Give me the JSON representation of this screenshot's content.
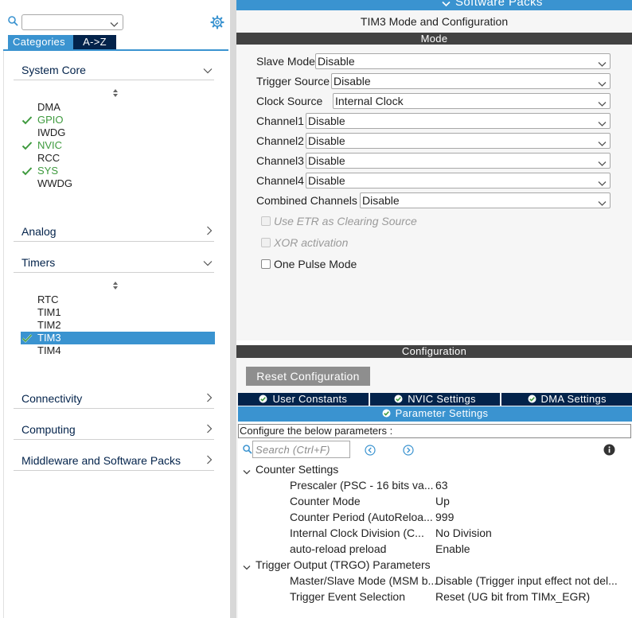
{
  "left_panel": {
    "tabs": [
      "Categories",
      "A->Z"
    ],
    "categories": [
      {
        "label": "System Core",
        "expanded": true,
        "items": [
          {
            "label": "DMA",
            "configured": false
          },
          {
            "label": "GPIO",
            "configured": true
          },
          {
            "label": "IWDG",
            "configured": false
          },
          {
            "label": "NVIC",
            "configured": true
          },
          {
            "label": "RCC",
            "configured": false
          },
          {
            "label": "SYS",
            "configured": true
          },
          {
            "label": "WWDG",
            "configured": false
          }
        ]
      },
      {
        "label": "Analog",
        "expanded": false
      },
      {
        "label": "Timers",
        "expanded": true,
        "items": [
          {
            "label": "RTC",
            "configured": false
          },
          {
            "label": "TIM1",
            "configured": false
          },
          {
            "label": "TIM2",
            "configured": false
          },
          {
            "label": "TIM3",
            "configured": true,
            "selected": true
          },
          {
            "label": "TIM4",
            "configured": false
          }
        ]
      },
      {
        "label": "Connectivity",
        "expanded": false
      },
      {
        "label": "Computing",
        "expanded": false
      },
      {
        "label": "Middleware and Software Packs",
        "expanded": false
      }
    ]
  },
  "top_bar": {
    "label": "Software Packs"
  },
  "right_panel": {
    "title": "TIM3 Mode and Configuration",
    "mode_header": "Mode",
    "mode_fields": [
      {
        "label": "Slave Mode",
        "value": "Disable"
      },
      {
        "label": "Trigger Source",
        "value": "Disable"
      },
      {
        "label": "Clock Source",
        "value": "Internal Clock"
      },
      {
        "label": "Channel1",
        "value": "Disable"
      },
      {
        "label": "Channel2",
        "value": "Disable"
      },
      {
        "label": "Channel3",
        "value": "Disable"
      },
      {
        "label": "Channel4",
        "value": "Disable"
      },
      {
        "label": "Combined Channels",
        "value": "Disable"
      }
    ],
    "checkboxes": [
      {
        "label": "Use ETR as Clearing Source",
        "enabled": false,
        "checked": false
      },
      {
        "label": "XOR activation",
        "enabled": false,
        "checked": false
      },
      {
        "label": "One Pulse Mode",
        "enabled": true,
        "checked": false
      }
    ],
    "configuration_header": "Configuration",
    "reset_button": "Reset Configuration",
    "tabs": [
      "User Constants",
      "NVIC Settings",
      "DMA Settings"
    ],
    "active_tab": "Parameter Settings",
    "config_message": "Configure the below parameters :",
    "search_placeholder": "Search (Ctrl+F)",
    "groups": [
      {
        "label": "Counter Settings",
        "params": [
          {
            "name": "Prescaler (PSC - 16 bits va...",
            "value": "63"
          },
          {
            "name": "Counter Mode",
            "value": "Up"
          },
          {
            "name": "Counter Period (AutoReloa...",
            "value": "999"
          },
          {
            "name": "Internal Clock Division (C...",
            "value": "No Division"
          },
          {
            "name": "auto-reload preload",
            "value": "Enable"
          }
        ]
      },
      {
        "label": "Trigger Output (TRGO) Parameters",
        "params": [
          {
            "name": "Master/Slave Mode (MSM b...",
            "value": "Disable (Trigger input effect not del..."
          },
          {
            "name": "Trigger Event Selection",
            "value": "Reset (UG bit from TIMx_EGR)"
          }
        ]
      }
    ]
  },
  "colors": {
    "accent_blue": "#3a93d0",
    "navy": "#03234b",
    "band_gray": "#424242",
    "configured_green": "#3e9a3e",
    "button_gray": "#8e8e8e"
  }
}
